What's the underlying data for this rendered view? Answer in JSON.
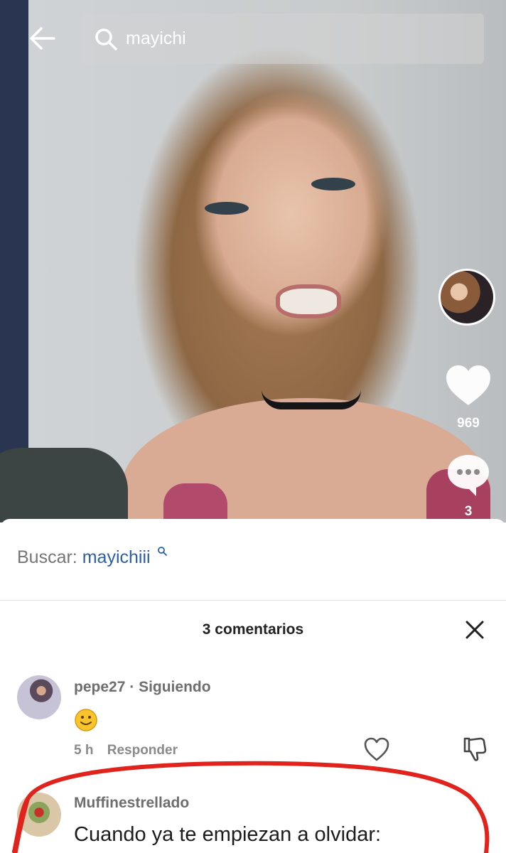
{
  "search": {
    "query": "mayichi"
  },
  "video": {
    "likes": "969",
    "comments": "3"
  },
  "sheet": {
    "search_prefix": "Buscar:",
    "search_term": "mayichiii",
    "title": "3 comentarios"
  },
  "comments": [
    {
      "user": "pepe27",
      "separator": "·",
      "status": "Siguiendo",
      "text_emoji": "slightly-smiling-face",
      "time": "5 h",
      "reply_label": "Responder"
    },
    {
      "user": "Muffinestrellado",
      "text": "Cuando ya te empiezan a olvidar:"
    }
  ],
  "colors": {
    "link_blue": "#2b5fa3",
    "annotation_red": "#e0231c",
    "emoji_yellow": "#f7c52b"
  },
  "icons": [
    "back-arrow-icon",
    "search-icon",
    "heart-icon",
    "comment-bubble-icon",
    "close-icon",
    "heart-outline-icon",
    "dislike-icon",
    "smiley-emoji-icon"
  ]
}
